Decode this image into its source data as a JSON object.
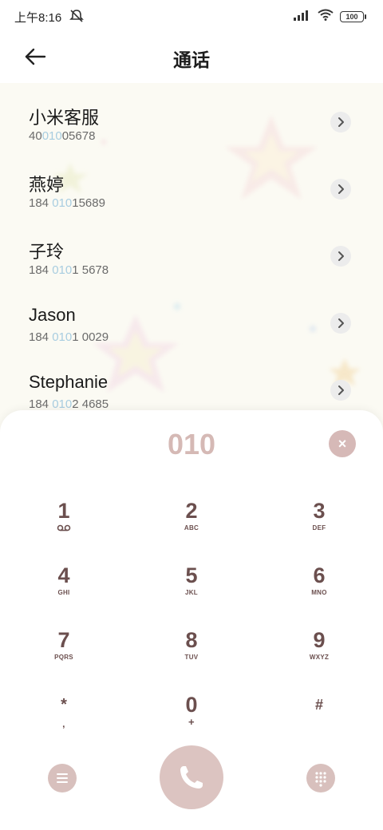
{
  "status_bar": {
    "time": "上午8:16",
    "battery": "100"
  },
  "header": {
    "title": "通话"
  },
  "contacts": [
    {
      "name": "小米客服",
      "num_pre": "40",
      "num_hl": "010",
      "num_post": "05678"
    },
    {
      "name": "燕婷",
      "num_pre": "184 ",
      "num_hl": "010",
      "num_post": "15689"
    },
    {
      "name": "子玲",
      "num_pre": "184 ",
      "num_hl": "010",
      "num_post": "1 5678"
    },
    {
      "name": "Jason",
      "num_pre": "184 ",
      "num_hl": "010",
      "num_post": "1 0029"
    },
    {
      "name": "Stephanie",
      "num_pre": "184 ",
      "num_hl": "010",
      "num_post": "2 4685"
    }
  ],
  "dialer": {
    "input": "010",
    "clear_symbol": "×",
    "keys": [
      {
        "digit": "1",
        "letters": ""
      },
      {
        "digit": "2",
        "letters": "ABC"
      },
      {
        "digit": "3",
        "letters": "DEF"
      },
      {
        "digit": "4",
        "letters": "GHI"
      },
      {
        "digit": "5",
        "letters": "JKL"
      },
      {
        "digit": "6",
        "letters": "MNO"
      },
      {
        "digit": "7",
        "letters": "PQRS"
      },
      {
        "digit": "8",
        "letters": "TUV"
      },
      {
        "digit": "9",
        "letters": "WXYZ"
      },
      {
        "digit": "*",
        "letters": ","
      },
      {
        "digit": "0",
        "letters": "+"
      },
      {
        "digit": "#",
        "letters": ""
      }
    ]
  },
  "colors": {
    "accent": "#d6b9b7",
    "key_text": "#6b4f4e",
    "highlight": "#a8cde0"
  }
}
